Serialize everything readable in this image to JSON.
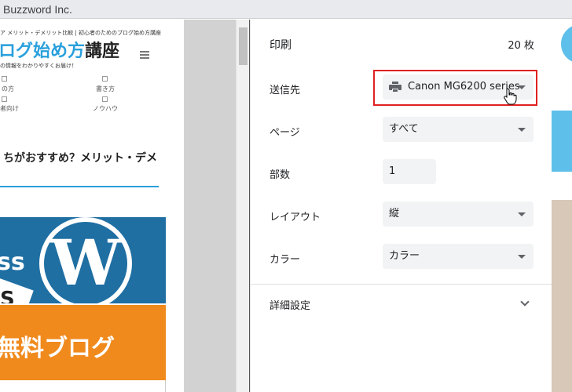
{
  "window": {
    "title": "Buzzword Inc."
  },
  "preview": {
    "header_small": "ア メリット・デメリット比較 | 初心者のためのブログ始め方講座",
    "logo_blue": "ログ始め方",
    "logo_dark": "講座",
    "tagline": "の情報をわかりやすくお届け！",
    "nav": {
      "item1": "の方",
      "item2": "書き方",
      "item3": "者向け",
      "item4": "ノウハウ"
    },
    "article_title": "ちがおすすめ？メリット・デメ",
    "image_text_ss": "ss",
    "image_text_s": "S",
    "image_text_free": "無料ブログ",
    "image_logo": "W"
  },
  "print_panel": {
    "title": "印刷",
    "sheet_count": "20 枚",
    "destination": {
      "label": "送信先",
      "value": "Canon MG6200 series"
    },
    "pages": {
      "label": "ページ",
      "value": "すべて"
    },
    "copies": {
      "label": "部数",
      "value": "1"
    },
    "layout": {
      "label": "レイアウト",
      "value": "縦"
    },
    "color": {
      "label": "カラー",
      "value": "カラー"
    },
    "more_settings": "詳細設定"
  },
  "colors": {
    "highlight": "#e02020",
    "accent_blue": "#29a0dc",
    "select_bg": "#f1f3f4"
  },
  "icons": [
    "printer-icon",
    "dropdown-caret-icon",
    "chevron-down-icon",
    "hamburger-menu-icon",
    "hand-cursor-icon"
  ]
}
